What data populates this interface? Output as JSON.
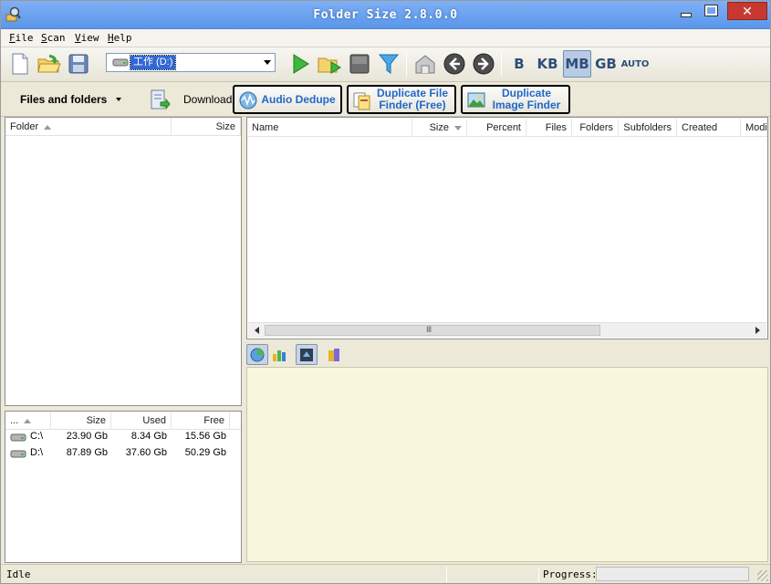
{
  "window": {
    "title": "Folder Size 2.8.0.0"
  },
  "menu": [
    {
      "label": "File"
    },
    {
      "label": "Scan"
    },
    {
      "label": "View"
    },
    {
      "label": "Help"
    }
  ],
  "toolbar": {
    "drive_selected": "工作 (D:)",
    "units": [
      {
        "label": "B",
        "active": false
      },
      {
        "label": "KB",
        "active": false
      },
      {
        "label": "MB",
        "active": true
      },
      {
        "label": "GB",
        "active": false
      },
      {
        "label": "AUTO",
        "active": false
      }
    ]
  },
  "download_bar": {
    "filter_label": "Files and folders",
    "download_label": "Download:",
    "products": [
      {
        "label": "Audio Dedupe"
      },
      {
        "label": "Duplicate File\nFinder (Free)"
      },
      {
        "label": "Duplicate\nImage Finder"
      }
    ]
  },
  "folder_tree": {
    "columns": [
      {
        "label": "Folder"
      },
      {
        "label": "Size"
      }
    ]
  },
  "drives_table": {
    "columns": [
      {
        "label": "..."
      },
      {
        "label": "Size"
      },
      {
        "label": "Used"
      },
      {
        "label": "Free"
      }
    ],
    "rows": [
      {
        "name": "C:\\",
        "size": "23.90 Gb",
        "used": "8.34 Gb",
        "free": "15.56 Gb"
      },
      {
        "name": "D:\\",
        "size": "87.89 Gb",
        "used": "37.60 Gb",
        "free": "50.29 Gb"
      }
    ]
  },
  "file_list": {
    "columns": [
      {
        "label": "Name"
      },
      {
        "label": "Size"
      },
      {
        "label": "Percent"
      },
      {
        "label": "Files"
      },
      {
        "label": "Folders"
      },
      {
        "label": "Subfolders"
      },
      {
        "label": "Created"
      },
      {
        "label": "Modi"
      }
    ]
  },
  "status": {
    "text": "Idle",
    "progress_label": "Progress:",
    "progress_fraction": 0
  },
  "colors": {
    "title_bar": "#6aa2ef",
    "accent_link": "#2168c8",
    "chart_bg": "#f8f7dd",
    "close_button": "#c7392f"
  }
}
